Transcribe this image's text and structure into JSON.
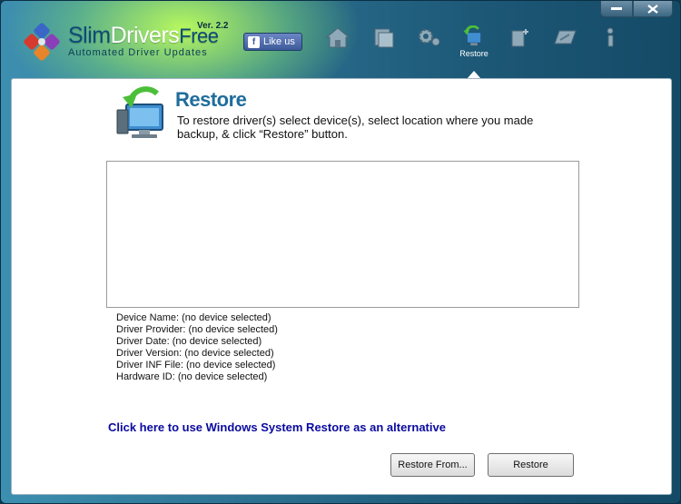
{
  "app": {
    "brand_slim": "Slim",
    "brand_drivers": "Drivers",
    "brand_free": "Free",
    "version": "Ver. 2.2",
    "tagline": "Automated Driver Updates"
  },
  "like_button": {
    "label": "Like us"
  },
  "nav": {
    "items": [
      {
        "icon": "home-icon",
        "label": ""
      },
      {
        "icon": "scan-icon",
        "label": ""
      },
      {
        "icon": "gear-icon",
        "label": ""
      },
      {
        "icon": "restore-icon",
        "label": "Restore"
      },
      {
        "icon": "backup-icon",
        "label": ""
      },
      {
        "icon": "tools-icon",
        "label": ""
      },
      {
        "icon": "info-icon",
        "label": ""
      }
    ],
    "active": "Restore"
  },
  "page": {
    "title": "Restore",
    "description": "To restore driver(s) select device(s), select location where you made backup, & click “Restore” button."
  },
  "details": {
    "device_name": "Device Name: (no device selected)",
    "driver_provider": "Driver Provider: (no device selected)",
    "driver_date": "Driver Date: (no device selected)",
    "driver_version": "Driver Version: (no device selected)",
    "driver_inf_file": "Driver INF File: (no device selected)",
    "hardware_id": "Hardware ID: (no device selected)"
  },
  "system_restore_link": "Click here to use Windows System Restore as an alternative",
  "buttons": {
    "restore_from": "Restore From...",
    "restore": "Restore"
  },
  "colors": {
    "accent_title": "#1f6d9c",
    "link": "#0a0aa0"
  }
}
